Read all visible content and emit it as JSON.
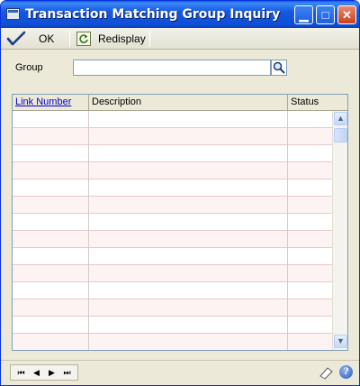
{
  "window": {
    "title": "Transaction Matching Group Inquiry"
  },
  "toolbar": {
    "ok_label": "OK",
    "redisplay_label": "Redisplay"
  },
  "group": {
    "label": "Group",
    "value": ""
  },
  "grid": {
    "columns": [
      "Link Number",
      "Description",
      "Status"
    ],
    "row_count": 14
  },
  "icons": {
    "window": "window-icon",
    "ok": "checkmark-icon",
    "redisplay": "refresh-icon",
    "lookup": "magnifier-icon",
    "note": "note-icon",
    "help": "help-icon"
  },
  "colors": {
    "title_bar": "#0f4fd6",
    "link": "#0000cc",
    "row_alt": "#fdf3f3"
  }
}
